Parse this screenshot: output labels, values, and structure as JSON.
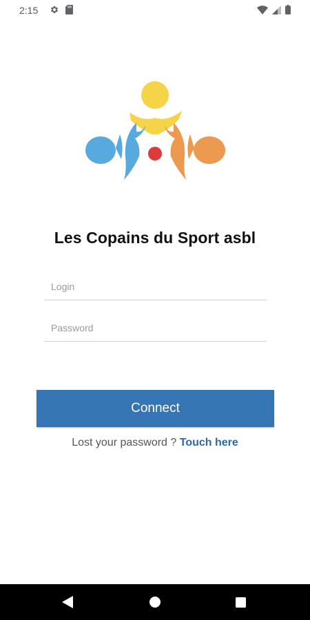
{
  "status_bar": {
    "time": "2:15",
    "left_icons": [
      "settings-icon",
      "sd-card-icon"
    ],
    "right_icons": [
      "wifi-icon",
      "signal-icon",
      "battery-icon"
    ]
  },
  "app": {
    "title": "Les Copains du Sport asbl",
    "logo_colors": {
      "yellow": "#f5d44a",
      "blue": "#58a9de",
      "orange": "#eb9a4f",
      "red": "#dd3b3b"
    }
  },
  "form": {
    "login_placeholder": "Login",
    "login_value": "",
    "password_placeholder": "Password",
    "password_value": ""
  },
  "actions": {
    "connect_label": "Connect",
    "lost_password_text": "Lost your password ? ",
    "touch_here_label": "Touch here"
  },
  "theme": {
    "accent": "#3575b3",
    "link": "#2b6aa6"
  },
  "nav_bar": {
    "buttons": [
      "back-icon",
      "home-icon",
      "recents-icon"
    ]
  }
}
